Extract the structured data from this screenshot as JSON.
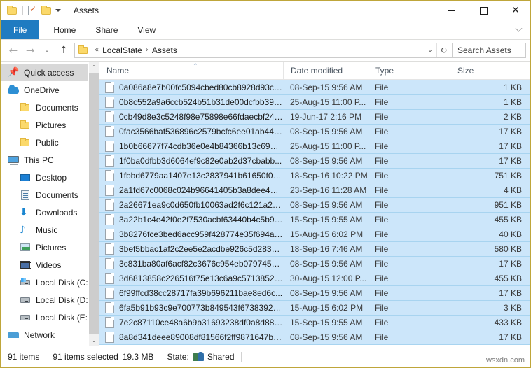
{
  "window": {
    "title": "Assets",
    "quick_access_toolbar": [
      {
        "name": "folder-icon",
        "label": ""
      },
      {
        "name": "properties-icon",
        "label": ""
      },
      {
        "name": "new-folder-icon",
        "label": ""
      },
      {
        "name": "customize-qat-caret-icon",
        "label": ""
      }
    ],
    "caption": {
      "minimize": "—",
      "maximize": "□",
      "close": "✕"
    }
  },
  "ribbon": {
    "tabs": [
      {
        "label": "File",
        "active": true
      },
      {
        "label": "Home",
        "active": false
      },
      {
        "label": "Share",
        "active": false
      },
      {
        "label": "View",
        "active": false
      }
    ],
    "collapse_icon": "chevron-down-icon",
    "file_tab_color": "#1f7bc1"
  },
  "address": {
    "back_icon": "←",
    "forward_icon": "→",
    "recent_icon": "⌄",
    "up_icon": "↑",
    "overflow": "«",
    "crumbs": [
      "LocalState",
      "Assets"
    ],
    "crumb_separator": "›",
    "dropdown_icon": "⌄",
    "refresh_icon": "↻",
    "search_placeholder": "Search Assets"
  },
  "navpane": {
    "items": [
      {
        "label": "Quick access",
        "icon": "star-pin-icon",
        "level": 0,
        "selected": true
      },
      {
        "label": "OneDrive",
        "icon": "onedrive-cloud-icon",
        "level": 0,
        "selected": false
      },
      {
        "label": "Documents",
        "icon": "folder-icon",
        "level": 1,
        "selected": false
      },
      {
        "label": "Pictures",
        "icon": "folder-icon",
        "level": 1,
        "selected": false
      },
      {
        "label": "Public",
        "icon": "folder-icon",
        "level": 1,
        "selected": false
      },
      {
        "label": "This PC",
        "icon": "this-pc-icon",
        "level": 0,
        "selected": false
      },
      {
        "label": "Desktop",
        "icon": "desktop-icon",
        "level": 1,
        "selected": false
      },
      {
        "label": "Documents",
        "icon": "documents-icon",
        "level": 1,
        "selected": false
      },
      {
        "label": "Downloads",
        "icon": "downloads-icon",
        "level": 1,
        "selected": false
      },
      {
        "label": "Music",
        "icon": "music-icon",
        "level": 1,
        "selected": false
      },
      {
        "label": "Pictures",
        "icon": "pictures-icon",
        "level": 1,
        "selected": false
      },
      {
        "label": "Videos",
        "icon": "videos-icon",
        "level": 1,
        "selected": false
      },
      {
        "label": "Local Disk (C:)",
        "icon": "system-disk-icon",
        "level": 1,
        "selected": false
      },
      {
        "label": "Local Disk (D:)",
        "icon": "disk-icon",
        "level": 1,
        "selected": false
      },
      {
        "label": "Local Disk (E:)",
        "icon": "disk-icon",
        "level": 1,
        "selected": false
      },
      {
        "label": "Network",
        "icon": "network-icon",
        "level": 0,
        "selected": false
      }
    ],
    "scroll_up_icon": "⌃",
    "scroll_down_icon": "⌄"
  },
  "filelist": {
    "columns": [
      "Name",
      "Date modified",
      "Type",
      "Size"
    ],
    "sort_column": "Name",
    "sort_direction": "asc",
    "sort_indicator": "⌃",
    "rows": [
      {
        "name": "0a086a8e7b00fc5094cbed80cb8928d93ca...",
        "date": "08-Sep-15 9:56 AM",
        "type": "File",
        "size": "1 KB"
      },
      {
        "name": "0b8c552a9a6ccb524b51b31de00dcfbb394...",
        "date": "25-Aug-15 11:00 P...",
        "type": "File",
        "size": "1 KB"
      },
      {
        "name": "0cb49d8e3c5248f98e75898e66fdaecbf247...",
        "date": "19-Jun-17 2:16 PM",
        "type": "File",
        "size": "2 KB"
      },
      {
        "name": "0fac3566baf536896c2579bcfc6ee01ab443...",
        "date": "08-Sep-15 9:56 AM",
        "type": "File",
        "size": "17 KB"
      },
      {
        "name": "1b0b66677f74cdb36e0e4b84366b13c696b...",
        "date": "25-Aug-15 11:00 P...",
        "type": "File",
        "size": "17 KB"
      },
      {
        "name": "1f0ba0dfbb3d6064ef9c82e0ab2d37cbabb...",
        "date": "08-Sep-15 9:56 AM",
        "type": "File",
        "size": "17 KB"
      },
      {
        "name": "1fbbd6779aa1407e13c2837941b61650f06f...",
        "date": "18-Sep-16 10:22 PM",
        "type": "File",
        "size": "751 KB"
      },
      {
        "name": "2a1fd67c0068c024b96641405b3a8dee4e9...",
        "date": "23-Sep-16 11:28 AM",
        "type": "File",
        "size": "4 KB"
      },
      {
        "name": "2a26671ea9c0d650fb10063ad2f6c121a22d...",
        "date": "08-Sep-15 9:56 AM",
        "type": "File",
        "size": "951 KB"
      },
      {
        "name": "3a22b1c4e42f0e2f7530acbf63440b4c5b97...",
        "date": "15-Sep-15 9:55 AM",
        "type": "File",
        "size": "455 KB"
      },
      {
        "name": "3b8276fce3bed6acc959f428774e35f694a5...",
        "date": "15-Aug-15 6:02 PM",
        "type": "File",
        "size": "40 KB"
      },
      {
        "name": "3bef5bbac1af2c2ee5e2acdbe926c5d2838...",
        "date": "18-Sep-16 7:46 AM",
        "type": "File",
        "size": "580 KB"
      },
      {
        "name": "3c831ba80af6acf82c3676c954eb07974543...",
        "date": "08-Sep-15 9:56 AM",
        "type": "File",
        "size": "17 KB"
      },
      {
        "name": "3d6813858c226516f75e13c6a9c571385239...",
        "date": "30-Aug-15 12:00 P...",
        "type": "File",
        "size": "455 KB"
      },
      {
        "name": "6f99ffcd38cc28717fa39b696211bae8ed6c...",
        "date": "08-Sep-15 9:56 AM",
        "type": "File",
        "size": "17 KB"
      },
      {
        "name": "6fa5b91b93c9e700773b849543f67383927c...",
        "date": "15-Aug-15 6:02 PM",
        "type": "File",
        "size": "3 KB"
      },
      {
        "name": "7e2c87110ce48a6b9b31693238df0a8d884...",
        "date": "15-Sep-15 9:55 AM",
        "type": "File",
        "size": "433 KB"
      },
      {
        "name": "8a8d341deee89008df81566f2ff9871647bd...",
        "date": "08-Sep-15 9:56 AM",
        "type": "File",
        "size": "17 KB"
      }
    ],
    "selection_color": "#cce6fa"
  },
  "statusbar": {
    "item_count": "91 items",
    "selected_count": "91 items selected",
    "selected_size": "19.3 MB",
    "state_label": "State:",
    "state_value": "Shared"
  },
  "watermark": "wsxdn.com"
}
